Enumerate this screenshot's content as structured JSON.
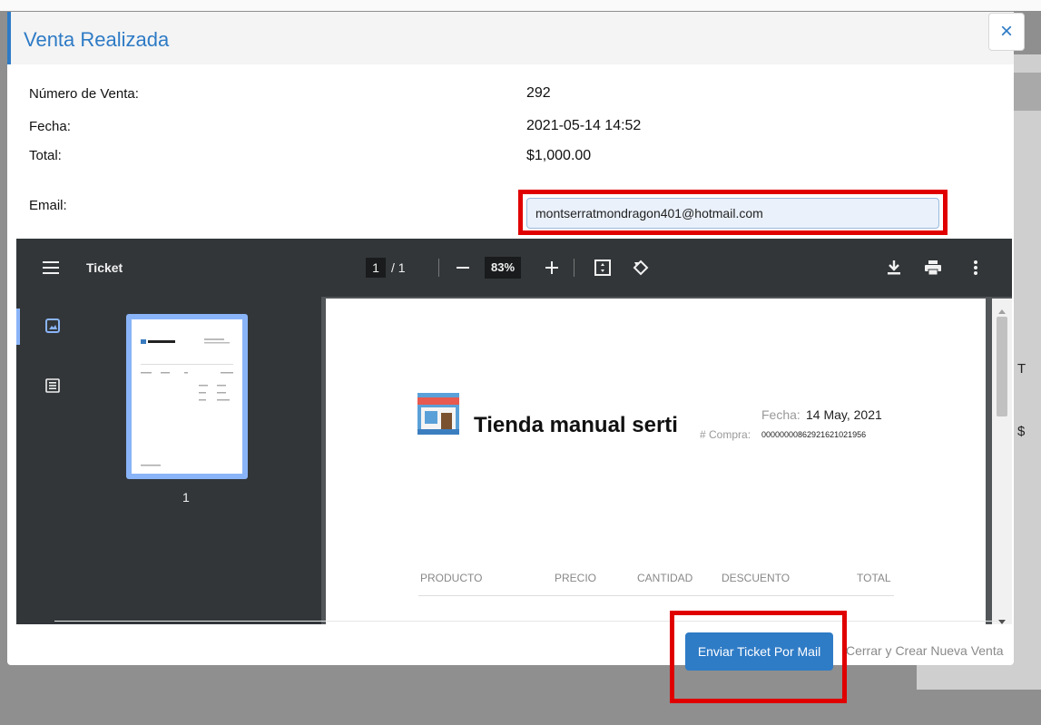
{
  "modal": {
    "title": "Venta Realizada",
    "close_label": "×"
  },
  "sale": {
    "number_label": "Número de Venta:",
    "number_value": "292",
    "date_label": "Fecha:",
    "date_value": "2021-05-14 14:52",
    "total_label": "Total:",
    "total_value": "$1,000.00",
    "email_label": "Email:",
    "email_value": "montserratmondragon401@hotmail.com"
  },
  "pdf_viewer": {
    "title": "Ticket",
    "page_current": "1",
    "page_total": "/ 1",
    "zoom": "83%",
    "thumbnail_page_number": "1"
  },
  "ticket": {
    "store_name": "Tienda manual serti",
    "date_label": "Fecha:",
    "date_value": "14 May, 2021",
    "purchase_label": "# Compra:",
    "purchase_value": "00000000862921621021956",
    "columns": [
      "PRODUCTO",
      "PRECIO",
      "CANTIDAD",
      "DESCUENTO",
      "TOTAL"
    ]
  },
  "footer": {
    "send_button": "Enviar Ticket Por Mail",
    "close_new_button": "Cerrar y Crear Nueva Venta"
  },
  "background": {
    "letter_1": "T",
    "letter_2": "$"
  },
  "colors": {
    "accent": "#2e7bc6",
    "highlight_box": "#e00000",
    "viewer_toolbar": "#323639"
  }
}
